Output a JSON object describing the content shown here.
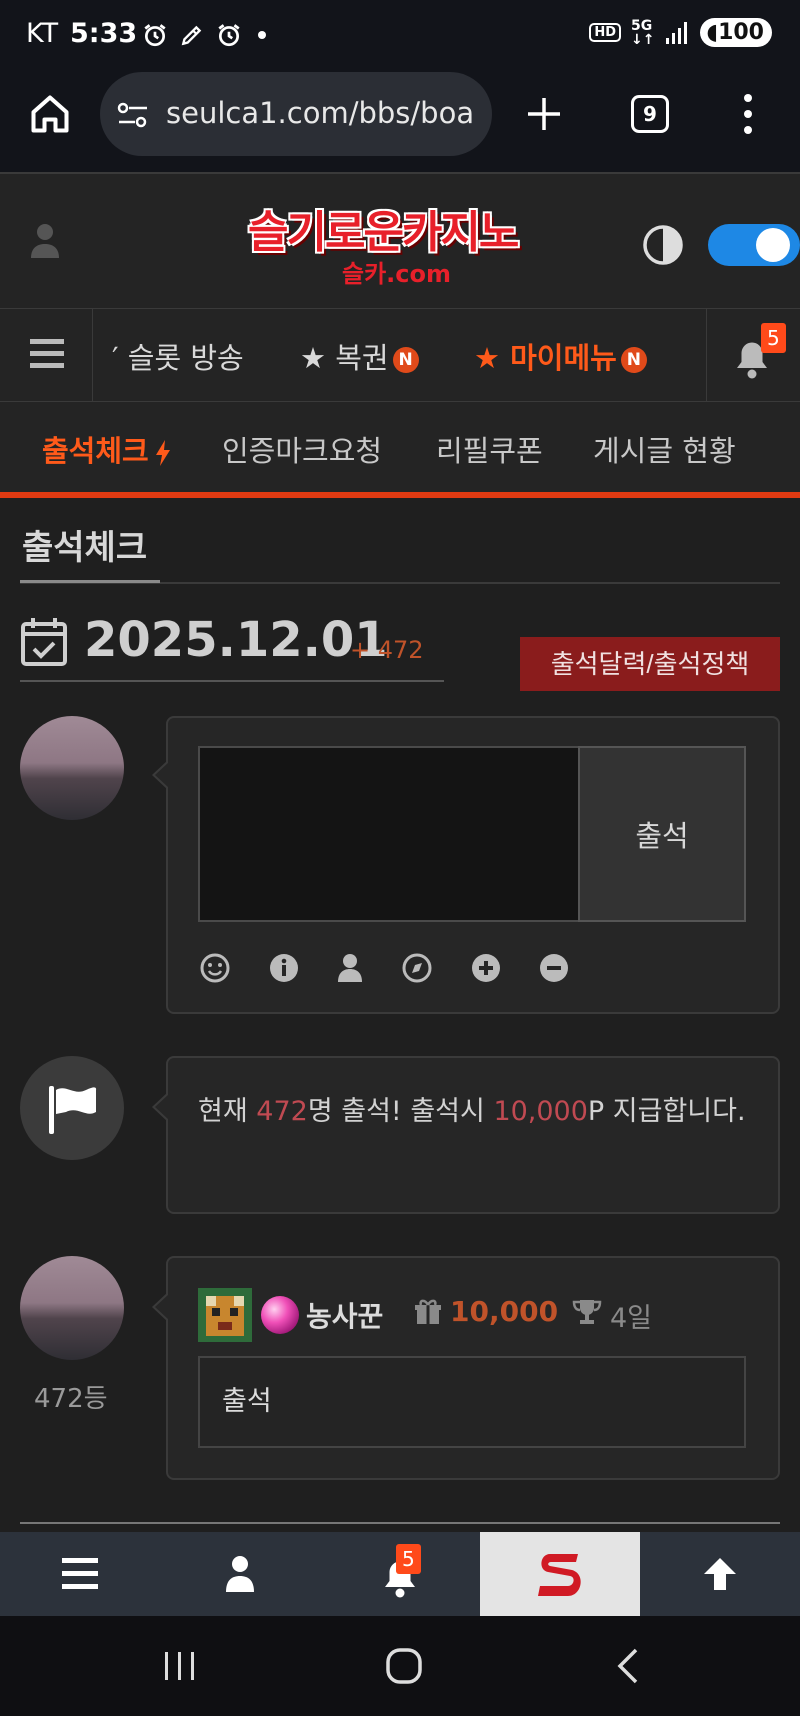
{
  "status_bar": {
    "carrier": "KT",
    "time": "5:33",
    "battery": "100"
  },
  "browser": {
    "url": "seulca1.com/bbs/boa",
    "tab_count": "9"
  },
  "site": {
    "logo_text": "슬기로운카지노",
    "logo_sub": "슬카.com"
  },
  "nav": {
    "items": [
      {
        "label": "′ 슬롯 방송"
      },
      {
        "label": "★ 복권",
        "badge": "N"
      },
      {
        "label": "★ 마이메뉴",
        "badge": "N"
      }
    ],
    "notification_count": "5"
  },
  "submenu": {
    "items": [
      "출석체크",
      "인증마크요청",
      "리필쿠폰",
      "게시글 현황"
    ]
  },
  "page": {
    "title": "출석체크",
    "date": "2025.12.01",
    "date_plus": "+ 472",
    "policy_button": "출석달력/출석정책"
  },
  "comment_form": {
    "input_value": "",
    "submit_label": "출석"
  },
  "info": {
    "prefix": "현재 ",
    "count": "472",
    "middle": "명 출석! 출석시 ",
    "points": "10,000",
    "suffix": "P 지급합니다."
  },
  "entry": {
    "name": "농사꾼",
    "points": "10,000",
    "days": "4일",
    "content": "출석",
    "rank": "472등"
  },
  "bottom_bar": {
    "notification_count": "5"
  },
  "colors": {
    "accent": "#e03a12",
    "toggle": "#1e88e5",
    "policy_button": "#8a1c1c",
    "highlight_value": "#c04a52"
  }
}
